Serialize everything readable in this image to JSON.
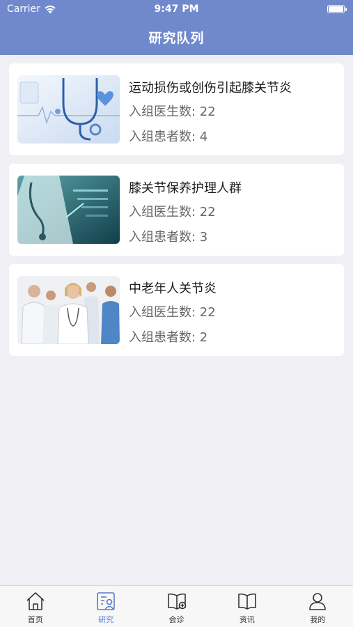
{
  "status_bar": {
    "carrier": "Carrier",
    "time": "9:47 PM"
  },
  "header": {
    "title": "研究队列"
  },
  "cohorts": [
    {
      "title": "运动损伤或创伤引起膝关节炎",
      "doctors": "入组医生数: 22",
      "patients": "入组患者数: 4",
      "image": "stethoscope-heart-image"
    },
    {
      "title": "膝关节保养护理人群",
      "doctors": "入组医生数: 22",
      "patients": "入组患者数: 3",
      "image": "doctor-hologram-image"
    },
    {
      "title": "中老年人关节炎",
      "doctors": "入组医生数: 22",
      "patients": "入组患者数: 2",
      "image": "medical-team-image"
    }
  ],
  "tabbar": {
    "items": [
      {
        "label": "首页",
        "icon": "home-icon"
      },
      {
        "label": "研究",
        "icon": "research-icon",
        "active": true
      },
      {
        "label": "会诊",
        "icon": "consult-icon"
      },
      {
        "label": "资讯",
        "icon": "book-icon"
      },
      {
        "label": "我的",
        "icon": "person-icon"
      }
    ]
  },
  "colors": {
    "header": "#7089cc",
    "active_tab": "#5b78c7",
    "background": "#efeff4"
  }
}
